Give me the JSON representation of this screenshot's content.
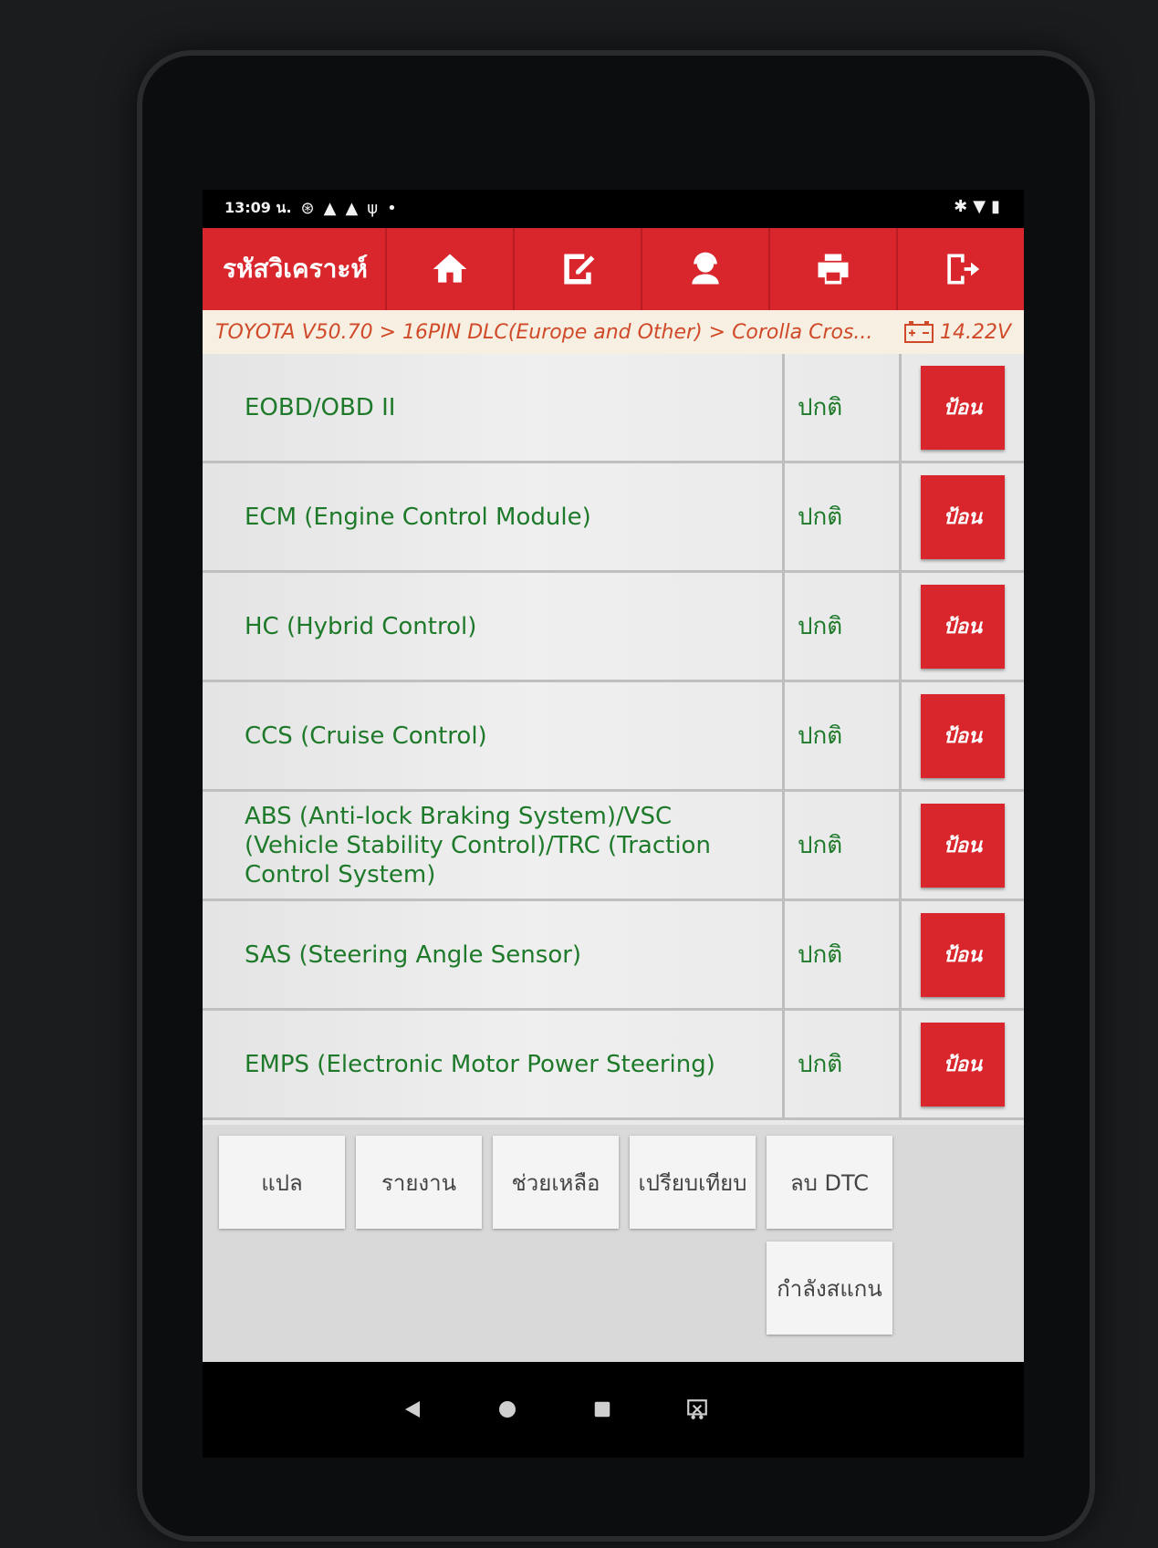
{
  "status_bar": {
    "time": "13:09 น.",
    "icons_left": [
      "nfc-icon",
      "warning-icon",
      "warning-icon",
      "usb-icon",
      "dot-icon"
    ],
    "icons_right": [
      "bluetooth-icon",
      "wifi-icon",
      "battery-icon"
    ]
  },
  "header": {
    "title": "รหัสวิเคราะห์",
    "buttons": [
      "home-icon",
      "edit-icon",
      "support-agent-icon",
      "print-icon",
      "exit-icon"
    ]
  },
  "breadcrumb": {
    "path": "TOYOTA V50.70 > 16PIN DLC(Europe and Other) > Corolla Cros...",
    "voltage": "14.22V"
  },
  "systems": [
    {
      "name": "EOBD/OBD II",
      "status": "ปกติ",
      "action": "ป้อน"
    },
    {
      "name": "ECM (Engine Control Module)",
      "status": "ปกติ",
      "action": "ป้อน"
    },
    {
      "name": "HC (Hybrid Control)",
      "status": "ปกติ",
      "action": "ป้อน"
    },
    {
      "name": "CCS (Cruise Control)",
      "status": "ปกติ",
      "action": "ป้อน"
    },
    {
      "name": "ABS (Anti-lock Braking System)/VSC (Vehicle Stability Control)/TRC (Traction Control System)",
      "status": "ปกติ",
      "action": "ป้อน"
    },
    {
      "name": "SAS (Steering Angle Sensor)",
      "status": "ปกติ",
      "action": "ป้อน"
    },
    {
      "name": "EMPS (Electronic Motor Power Steering)",
      "status": "ปกติ",
      "action": "ป้อน"
    }
  ],
  "toolbar": {
    "translate": "แปล",
    "report": "รายงาน",
    "help": "ช่วยเหลือ",
    "compare": "เปรียบเทียบ",
    "clear_dtc": "ลบ DTC",
    "scanning": "กำลังสแกน"
  },
  "colors": {
    "accent": "#d8262c",
    "ok_text": "#1e7a2a",
    "breadcrumb_text": "#d04a2a"
  }
}
